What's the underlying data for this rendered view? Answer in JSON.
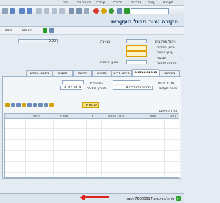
{
  "menu": {
    "items": [
      "מערכת",
      "עזרה",
      "הגדרות",
      "סביבה",
      "עריכה",
      "מעבר אל",
      "צור",
      "מערכת"
    ]
  },
  "title": "סקירה :צור ניהול מעקבים",
  "app_toolbar": {
    "save_label": "שמור",
    "print_label": "הדפסה"
  },
  "header_fields": {
    "doc_type_label": "ניהול מעקבים",
    "status_label": "אב-ינה",
    "status_value": "0.00",
    "org_label": "ארגון מכירות",
    "dist_label": "ערוץ הפצה",
    "division_label": "חטיבה",
    "partner_label": "מבקש הזמנה",
    "partner_hint": "נמען הזמנה"
  },
  "tabs": [
    {
      "label": "מכירות"
    },
    {
      "label": "סטטוס פריטים"
    },
    {
      "label": "פירוט פריט"
    },
    {
      "label": "הזמנה"
    },
    {
      "label": "רכישה"
    },
    {
      "label": "סטטוס"
    },
    {
      "label": "נתונים נוספים"
    },
    {
      "label": "מנות כלליות"
    }
  ],
  "active_tab": 1,
  "detail": {
    "doc_date_label": "תאריך ייחוס",
    "doc_date_placeholder": "",
    "valid_from_label": "בתוקף עד",
    "valid_from_value": "",
    "req_date_label": "תאריך מסירה",
    "req_date_value": "30.07.2019",
    "reason_label": "סיבת מעקב",
    "reason_value": "A1 מחובר לבצירה",
    "priority_label": "תאריך ייחוס"
  },
  "grid": {
    "title": "כל הפריטים",
    "columns": [
      "פריט",
      "חומר",
      "כמות הזמנה",
      "יח'",
      "תאריך",
      "תיאור"
    ],
    "button_label": "קטגוריות"
  },
  "status": {
    "message": "ניהול מעקבים 70000017 נשמר"
  }
}
